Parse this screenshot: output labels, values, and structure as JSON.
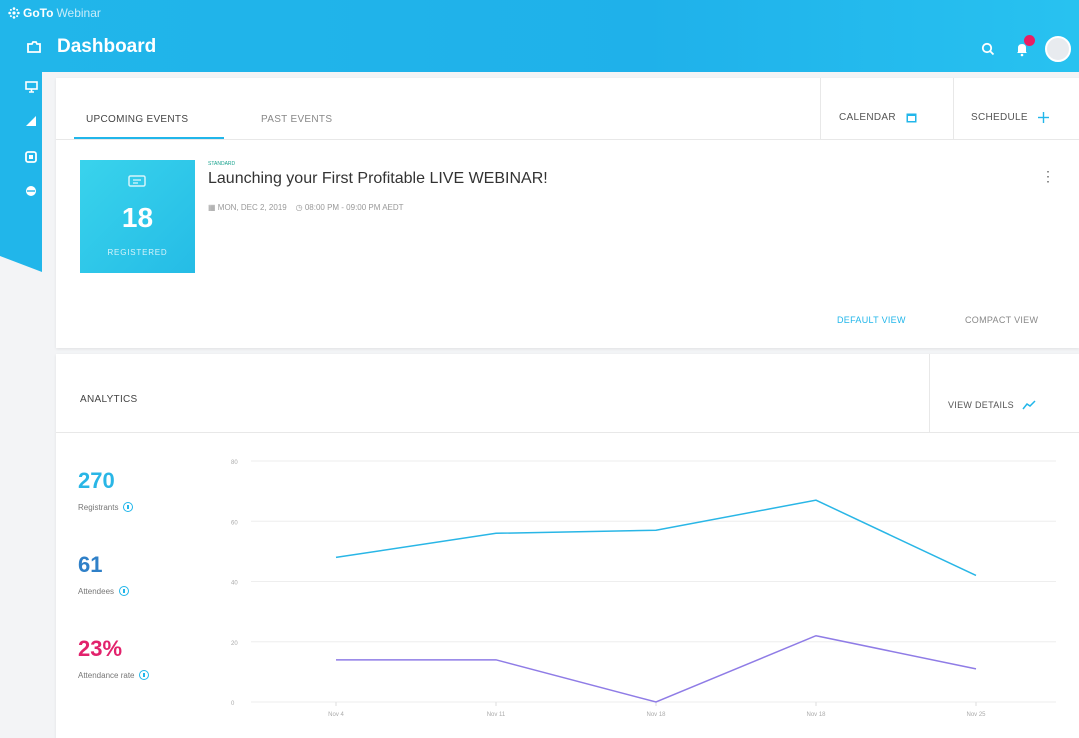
{
  "app": {
    "brand": "GoTo",
    "brand_suffix": "Webinar",
    "page_title": "Dashboard"
  },
  "tabs": {
    "upcoming": "UPCOMING EVENTS",
    "past": "PAST EVENTS",
    "calendar": "CALENDAR",
    "schedule": "SCHEDULE"
  },
  "event": {
    "tag": "STANDARD",
    "title": "Launching your First Profitable LIVE WEBINAR!",
    "date": "MON, DEC 2, 2019",
    "time": "08:00 PM - 09:00 PM AEDT",
    "registered_count": "18",
    "registered_label": "REGISTERED"
  },
  "views": {
    "default": "DEFAULT VIEW",
    "compact": "COMPACT VIEW"
  },
  "analytics": {
    "title": "ANALYTICS",
    "view_details": "VIEW DETAILS",
    "registrants_value": "270",
    "registrants_label": "Registrants",
    "attendees_value": "61",
    "attendees_label": "Attendees",
    "rate_value": "23%",
    "rate_label": "Attendance rate"
  },
  "colors": {
    "primary": "#21b6ea",
    "registrants": "#29b6e6",
    "attendees": "#2f80c8",
    "rate": "#e2226c",
    "attendees_line": "#8f7ce6"
  },
  "icons": {
    "sidebar": [
      "monitor-icon",
      "bar-chart-icon",
      "box-icon",
      "globe-icon"
    ],
    "header": [
      "search-icon",
      "bell-icon",
      "avatar"
    ]
  },
  "chart_data": {
    "type": "line",
    "categories": [
      "Nov 4",
      "Nov 11",
      "Nov 18",
      "Nov 18",
      "Nov 25"
    ],
    "yticks": [
      0,
      20,
      40,
      60,
      80
    ],
    "ylim": [
      0,
      80
    ],
    "grid": true,
    "series": [
      {
        "values": [
          48,
          56,
          57,
          67,
          42
        ],
        "color": "#29b6e6"
      },
      {
        "values": [
          14,
          14,
          0,
          22,
          11
        ],
        "color": "#8f7ce6"
      }
    ]
  }
}
